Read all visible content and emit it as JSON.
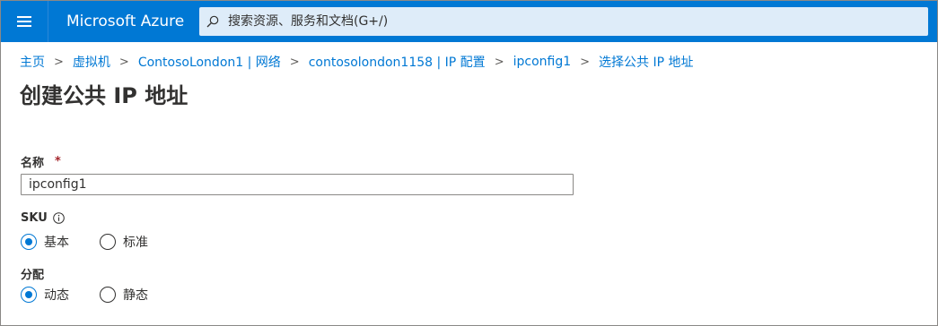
{
  "header": {
    "brand": "Microsoft Azure",
    "search_placeholder": "搜索资源、服务和文档(G+/)"
  },
  "breadcrumb": [
    "主页",
    "虚拟机",
    "ContosoLondon1 | 网络",
    "contosolondon1158 | IP 配置",
    "ipconfig1",
    "选择公共 IP 地址"
  ],
  "page": {
    "title": "创建公共 IP 地址"
  },
  "form": {
    "name": {
      "label": "名称",
      "required_mark": "*",
      "value": "ipconfig1"
    },
    "sku": {
      "label": "SKU",
      "options": [
        {
          "label": "基本",
          "selected": true
        },
        {
          "label": "标准",
          "selected": false
        }
      ]
    },
    "assignment": {
      "label": "分配",
      "options": [
        {
          "label": "动态",
          "selected": true
        },
        {
          "label": "静态",
          "selected": false
        }
      ]
    }
  },
  "colors": {
    "brand_blue": "#0078d4",
    "search_bg": "#deecf9",
    "required_red": "#a4262c"
  },
  "icons": [
    "menu-icon",
    "search-icon",
    "info-icon"
  ]
}
